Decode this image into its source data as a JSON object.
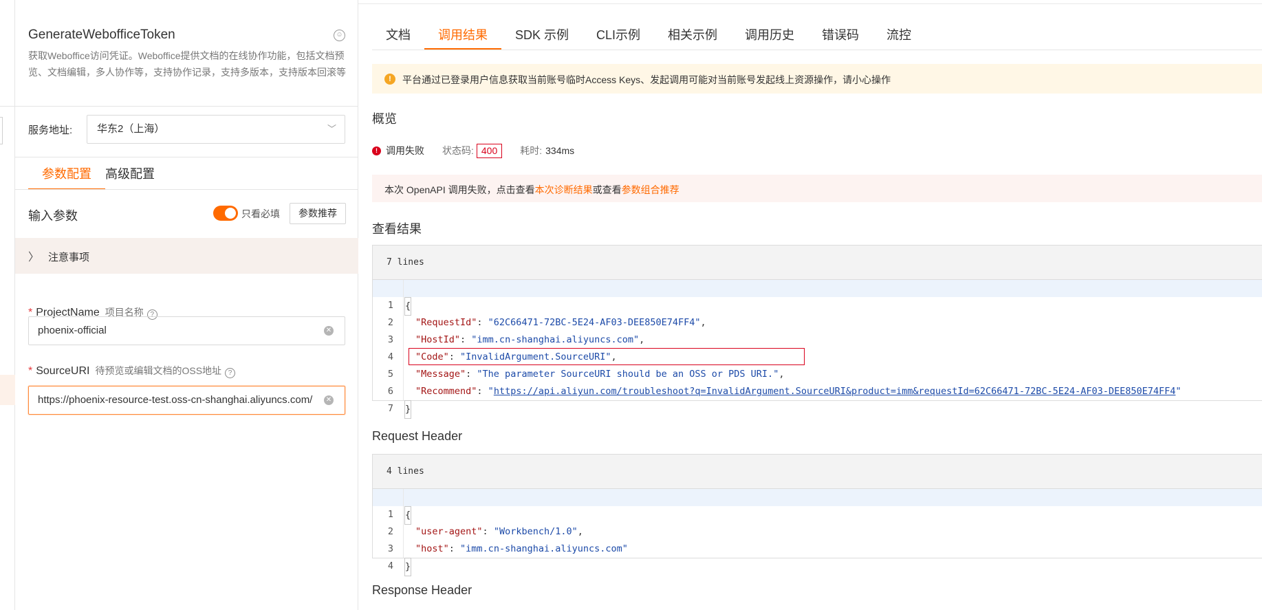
{
  "api": {
    "name": "GenerateWebofficeToken",
    "description": "获取Weboffice访问凭证。Weboffice提供文档的在线协作功能，包括文档预览、文档编辑，多人协作等，支持协作记录，支持多版本，支持版本回滚等",
    "service_address_label": "服务地址:",
    "service_address_value": "华东2（上海）"
  },
  "left_tabs": [
    {
      "label": "参数配置",
      "active": true
    },
    {
      "label": "高级配置",
      "active": false
    }
  ],
  "params": {
    "title": "输入参数",
    "toggle_label": "只看必填",
    "toggle_on": true,
    "recommend_button": "参数推荐",
    "notice_label": "注意事项",
    "fields": [
      {
        "required": "*",
        "name": "ProjectName",
        "desc": "项目名称",
        "value": "phoenix-official"
      },
      {
        "required": "*",
        "name": "SourceURI",
        "desc": "待预览或编辑文档的OSS地址",
        "value": "https://phoenix-resource-test.oss-cn-shanghai.aliyuncs.com/"
      }
    ]
  },
  "right_tabs": [
    {
      "label": "文档",
      "active": false
    },
    {
      "label": "调用结果",
      "active": true
    },
    {
      "label": "SDK 示例",
      "active": false
    },
    {
      "label": "CLI示例",
      "active": false
    },
    {
      "label": "相关示例",
      "active": false
    },
    {
      "label": "调用历史",
      "active": false
    },
    {
      "label": "错误码",
      "active": false
    },
    {
      "label": "流控",
      "active": false
    }
  ],
  "warning": "平台通过已登录用户信息获取当前账号临时Access Keys、发起调用可能对当前账号发起线上资源操作，请小心操作",
  "overview": {
    "title": "概览",
    "status": "调用失败",
    "status_code_label": "状态码:",
    "status_code": "400",
    "elapsed_label": "耗时:",
    "elapsed": "334ms"
  },
  "fail_notice": {
    "prefix": "本次 OpenAPI 调用失败，点击查看",
    "link1": "本次诊断结果",
    "middle": "或查看",
    "link2": "参数组合推荐"
  },
  "result": {
    "title": "查看结果",
    "lines_label": "7 lines",
    "fields": [
      {
        "key": "\"RequestId\"",
        "value": "\"62C66471-72BC-5E24-AF03-DEE850E74FF4\"",
        "suffix": ","
      },
      {
        "key": "\"HostId\"",
        "value": "\"imm.cn-shanghai.aliyuncs.com\"",
        "suffix": ","
      },
      {
        "key": "\"Code\"",
        "value": "\"InvalidArgument.SourceURI\"",
        "suffix": ","
      },
      {
        "key": "\"Message\"",
        "value": "\"The parameter SourceURI should be an OSS or PDS URI.\"",
        "suffix": ","
      },
      {
        "key": "\"Recommend\"",
        "value_prefix": "\"",
        "link": "https://api.aliyun.com/troubleshoot?q=InvalidArgument.SourceURI&product=imm&requestId=62C66471-72BC-5E24-AF03-DEE850E74FF4",
        "value_suffix": "\""
      }
    ]
  },
  "request_header": {
    "title": "Request Header",
    "lines_label": "4 lines",
    "fields": [
      {
        "key": "\"user-agent\"",
        "value": "\"Workbench/1.0\"",
        "suffix": ","
      },
      {
        "key": "\"host\"",
        "value": "\"imm.cn-shanghai.aliyuncs.com\"",
        "suffix": ""
      }
    ]
  },
  "response_header": {
    "title": "Response Header"
  },
  "code_syntax": {
    "open_brace": "{",
    "close_brace": "}",
    "colon": ": ",
    "line_numbers": [
      "1",
      "2",
      "3",
      "4",
      "5",
      "6",
      "7"
    ]
  },
  "icons": {
    "feedback": "smile-face-icon",
    "chevron_down": "chevron-down-icon",
    "chevron_right": "chevron-right-icon",
    "help": "help-circle-icon",
    "clear": "clear-circle-icon",
    "warning": "warning-circle-icon",
    "error": "error-circle-icon"
  },
  "colors": {
    "accent": "#ff6a00",
    "error": "#d9001b",
    "warning_bg": "#fff7e6",
    "fail_bg": "#fdf3f1"
  }
}
